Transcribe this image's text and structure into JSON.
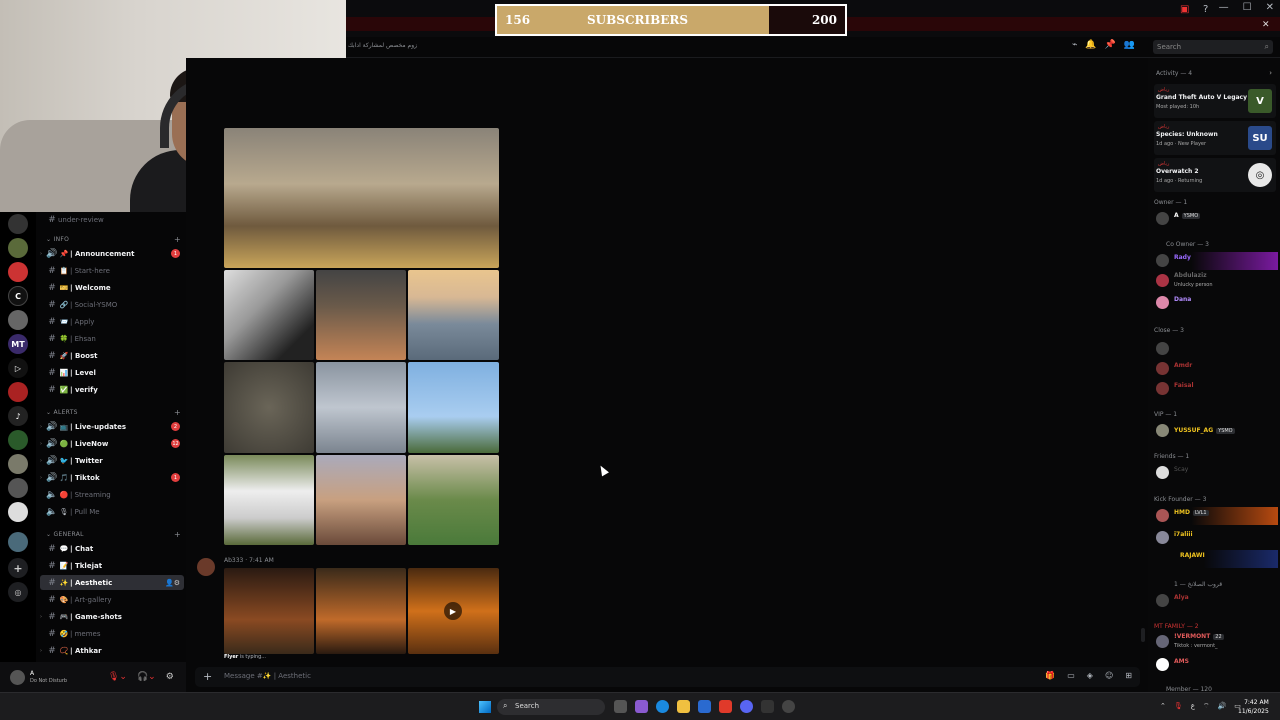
{
  "overlay": {
    "current": "156",
    "label": "SUBSCRIBERS",
    "goal": "200"
  },
  "header": {
    "topic": "زوم مخصص لمشاركة ادابك",
    "search_placeholder": "Search"
  },
  "categories": [
    {
      "label": "INFO"
    },
    {
      "label": "ALERTS"
    },
    {
      "label": "GENERAL"
    }
  ],
  "channels": [
    {
      "name": "under-review",
      "emoji": ""
    },
    {
      "name": "| Announcement",
      "emoji": "📌",
      "badge": "1"
    },
    {
      "name": "| Start-here",
      "emoji": "📋"
    },
    {
      "name": "| Welcome",
      "emoji": "🎫"
    },
    {
      "name": "| Social-YSMO",
      "emoji": "🔗"
    },
    {
      "name": "| Apply",
      "emoji": "📨"
    },
    {
      "name": "| Ehsan",
      "emoji": "🍀"
    },
    {
      "name": "| Boost",
      "emoji": "🚀"
    },
    {
      "name": "| Level",
      "emoji": "📊"
    },
    {
      "name": "| verify",
      "emoji": "✅"
    },
    {
      "name": "| Live-updates",
      "emoji": "📺",
      "badge": "2"
    },
    {
      "name": "| LiveNow",
      "emoji": "🟢",
      "badge": "12"
    },
    {
      "name": "| Twitter",
      "emoji": "🐦"
    },
    {
      "name": "| Tiktok",
      "emoji": "🎵",
      "badge": "1"
    },
    {
      "name": "| Streaming",
      "emoji": "🔴"
    },
    {
      "name": "| Pull Me",
      "emoji": "🎙"
    },
    {
      "name": "| Chat",
      "emoji": "💬"
    },
    {
      "name": "| Tklejat",
      "emoji": "📝"
    },
    {
      "name": "| Aesthetic",
      "emoji": "✨"
    },
    {
      "name": "| Art-gallery",
      "emoji": "🎨"
    },
    {
      "name": "| Game-shots",
      "emoji": "🎮"
    },
    {
      "name": "| memes",
      "emoji": "🤣"
    },
    {
      "name": "| Athkar",
      "emoji": "📿"
    }
  ],
  "user": {
    "name": "A",
    "status": "Do Not Disturb"
  },
  "message": {
    "author": "Ab333",
    "time": "7:41 AM"
  },
  "typing": {
    "who": "Flyer",
    "text": " is typing..."
  },
  "composer": {
    "placeholder": "Message #✨ | Aesthetic"
  },
  "activity": {
    "title": "Activity — 4",
    "cards": [
      {
        "who": "رياض",
        "game": "Grand Theft Auto V Legacy",
        "sub": "Most played: 10h",
        "icon": "V"
      },
      {
        "who": "رياض",
        "game": "Species: Unknown",
        "sub": "1d ago · New Player",
        "icon": "SU"
      },
      {
        "who": "رياض",
        "game": "Overwatch 2",
        "sub": "1d ago · Returning",
        "icon": "◎"
      }
    ]
  },
  "groups": {
    "owner": "Owner — 1",
    "coowner": "Co Owner — 3",
    "close": "Close — 3",
    "vip": "VIP — 1",
    "friends": "Friends — 1",
    "kick": "Kick Founder — 3",
    "arabic": "قروب الصلانخ — 1",
    "mtfamily": "MT FAMILY — 2",
    "member": "Member — 120"
  },
  "members": {
    "owner": {
      "name": "A",
      "tag": "YSMO"
    },
    "co1": {
      "name": "Rady"
    },
    "co2": {
      "name": "Abdulaziz",
      "sub": "Unlucky person"
    },
    "co3": {
      "name": "Dana"
    },
    "close2": {
      "name": "Amdr"
    },
    "close3": {
      "name": "Faisal"
    },
    "vip": {
      "name": "YUSSUF_AG",
      "tag": "YSMO"
    },
    "friend": {
      "name": "Scay"
    },
    "kick1": {
      "name": "HMD",
      "tag": "LVL1"
    },
    "kick2": {
      "name": "i7aliii"
    },
    "kick3": {
      "name": "RAJAWI"
    },
    "ar": {
      "name": "Alya"
    },
    "mt1": {
      "name": "!VERMONT",
      "tag": "22",
      "sub": "Tiktok : vermont_"
    },
    "mt2": {
      "name": "AMS"
    }
  },
  "taskbar": {
    "search": "Search",
    "time": "7:42 AM",
    "date": "11/6/2025"
  },
  "colors": {
    "accent": "#c9a86a",
    "bg": "#070708",
    "danger": "#e13e3e",
    "vip": "#f0c420",
    "purple": "#b38cff"
  }
}
